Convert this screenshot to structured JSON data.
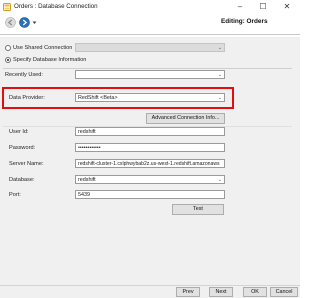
{
  "window": {
    "title": "Orders : Database Connection",
    "minimize": "–",
    "maximize": "☐",
    "close": "✕"
  },
  "header": {
    "editing_label": "Editing:  Orders"
  },
  "connection": {
    "use_shared_label": "Use Shared Connection",
    "specify_label": "Specify Database Information"
  },
  "form": {
    "recently_used_label": "Recently Used:",
    "recently_used_value": "",
    "data_provider_label": "Data Provider:",
    "data_provider_value": "RedShift <Beta>",
    "advanced_button": "Advanced Connection Info...",
    "user_id_label": "User Id:",
    "user_id_value": "redshift",
    "password_label": "Password:",
    "password_value": "••••••••••••",
    "server_name_label": "Server Name:",
    "server_name_value": "redshift-cluster-1.cxlphwybab2z.us-west-1.redshift.amazonaws",
    "database_label": "Database:",
    "database_value": "redshift",
    "port_label": "Port:",
    "port_value": "5439",
    "test_button": "Test"
  },
  "footer": {
    "prev": "Prev",
    "next": "Next",
    "ok": "OK",
    "cancel": "Cancel"
  },
  "colors": {
    "highlight": "#e01010",
    "panel": "#f0f0f0"
  }
}
